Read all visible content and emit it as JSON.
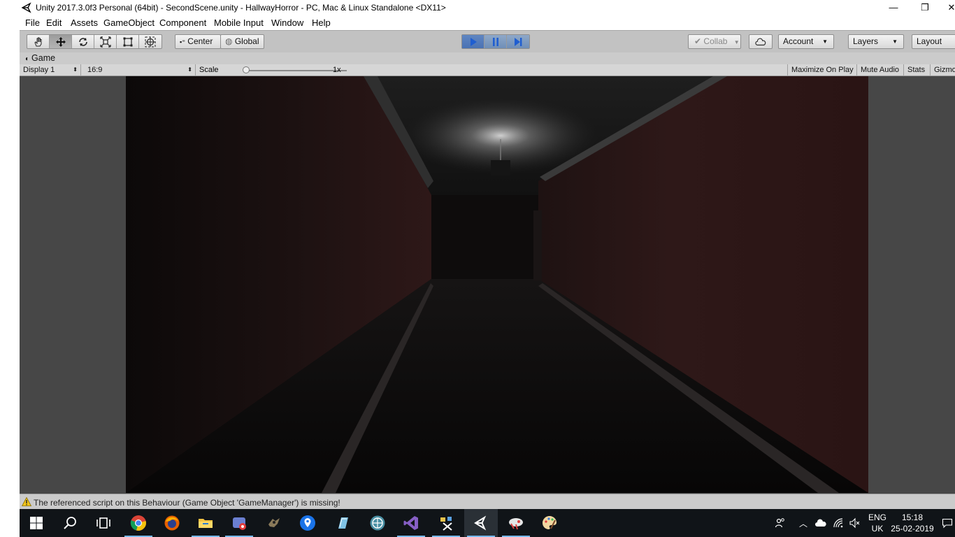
{
  "window": {
    "title": "Unity 2017.3.0f3 Personal (64bit) - SecondScene.unity - HallwayHorror - PC, Mac & Linux Standalone <DX11>",
    "min_glyph": "—",
    "max_glyph": "❐",
    "close_glyph": "✕"
  },
  "menu": {
    "items": [
      "File",
      "Edit",
      "Assets",
      "GameObject",
      "Component",
      "Mobile Input",
      "Window",
      "Help"
    ]
  },
  "toolbar": {
    "tools": [
      "hand-tool",
      "move-tool",
      "rotate-tool",
      "scale-tool",
      "rect-tool",
      "transform-tool"
    ],
    "active_tool": "move-tool",
    "pivot_label": "Center",
    "space_label": "Global",
    "collab_label": "Collab",
    "account_label": "Account",
    "layers_label": "Layers",
    "layout_label": "Layout"
  },
  "game_tab": {
    "label": "Game"
  },
  "game_bar": {
    "display": "Display 1",
    "aspect": "16:9",
    "scale_label": "Scale",
    "scale_value": "1x",
    "scale_fraction": 0.0,
    "maximize_on_play": "Maximize On Play",
    "mute_audio": "Mute Audio",
    "stats": "Stats",
    "gizmos": "Gizmos"
  },
  "status": {
    "message": "The referenced script on this Behaviour (Game Object 'GameManager') is missing!"
  },
  "taskbar": {
    "apps": [
      "start-icon",
      "search-icon",
      "task-view-icon",
      "chrome-icon",
      "firefox-icon",
      "file-explorer-icon",
      "app-icon-6",
      "app-icon-7",
      "maps-icon",
      "app-icon-9",
      "app-icon-10",
      "visual-studio-icon",
      "app-icon-12",
      "unity-icon",
      "app-icon-14",
      "paint-icon"
    ],
    "language": "ENG",
    "region": "UK",
    "time": "15:18",
    "date": "25-02-2019"
  }
}
